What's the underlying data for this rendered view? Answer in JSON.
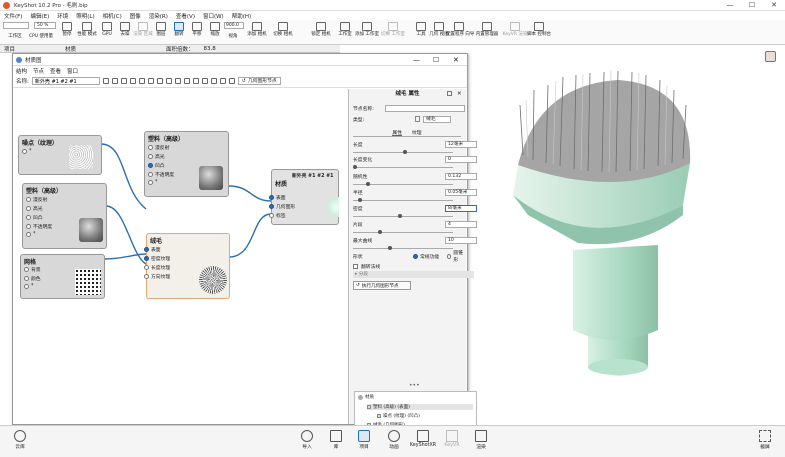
{
  "app": {
    "title": "KeyShot 10.2 Pro - 毛刷.bip",
    "min": "—",
    "max": "☐",
    "close": "✕"
  },
  "menu": [
    "文件(F)",
    "编辑(E)",
    "环境",
    "照明(L)",
    "相机(C)",
    "图像",
    "渲染(R)",
    "查看(V)",
    "窗口(W)",
    "帮助(H)"
  ],
  "toolbar": {
    "dropdown1": "",
    "zoom": "50 %",
    "zoom2": "900.0",
    "items": [
      {
        "label": "工作区"
      },
      {
        "label": "CPU 使用量"
      },
      {
        "label": "暂停"
      },
      {
        "label": "性能 模式"
      },
      {
        "label": "GPU"
      },
      {
        "label": "去噪"
      },
      {
        "label": "渲染 区域"
      },
      {
        "label": "图层"
      },
      {
        "label": "翻转"
      },
      {
        "label": "平移"
      },
      {
        "label": "缩放"
      },
      {
        "label": "视角"
      },
      {
        "label": "添加 相机"
      },
      {
        "label": "切换 相机"
      },
      {
        "label": "锁定 相机"
      },
      {
        "label": "工作室"
      },
      {
        "label": "添加 工作室"
      },
      {
        "label": "切换 工作室"
      },
      {
        "label": "工具"
      },
      {
        "label": "几何 视图"
      },
      {
        "label": "配置程序 向导"
      },
      {
        "label": "内置管理器"
      },
      {
        "label": "KeyVR 渲染"
      },
      {
        "label": "脚本 控制台"
      }
    ]
  },
  "subbar": {
    "left": "项目",
    "mid": "材质",
    "right": "面积倍数：",
    "right_val": "83.8"
  },
  "graph_window": {
    "title": "材质图",
    "menu": [
      "结构",
      "节点",
      "查看",
      "窗口"
    ],
    "name_label": "名称:",
    "name_value": "新外壳 #1 #2 #1",
    "search": "几何图形节点",
    "nodes": {
      "noise": {
        "title": "噪点（纹理）",
        "ports": [
          "*"
        ]
      },
      "plastic_top": {
        "title": "塑料（高级）",
        "ports": [
          "漫反射",
          "高光",
          "凹凸",
          "不透明度",
          "*"
        ]
      },
      "plastic_left": {
        "title": "塑料（高级）",
        "ports": [
          "漫反射",
          "高光",
          "凹凸",
          "不透明度",
          "*"
        ]
      },
      "grid": {
        "title": "网格",
        "ports": [
          "背景",
          "颜色",
          "*"
        ]
      },
      "fuzz": {
        "title": "绒毛",
        "ports": [
          "表面",
          "密度纹理",
          "长度纹理",
          "方向纹理"
        ]
      },
      "material": {
        "header": "新外壳 #1 #2 #1",
        "title": "材质",
        "ports": [
          "表面",
          "几何图形",
          "标签"
        ]
      }
    }
  },
  "props": {
    "header_a": "绒毛",
    "header_b": "属性",
    "node_name_label": "节点名称:",
    "node_name": "",
    "type_label": "类型:",
    "type_value": "绒毛",
    "tab_props": "属性",
    "tab_tex": "纹理",
    "rows": [
      {
        "label": "长度",
        "value": "12毫米",
        "knob": 0.5
      },
      {
        "label": "长度变化",
        "value": "0",
        "knob": 0.0
      },
      {
        "label": "随机性",
        "value": "0.132",
        "knob": 0.13
      },
      {
        "label": "半径",
        "value": "0.05毫米",
        "knob": 0.05
      },
      {
        "label": "密度",
        "value": "8/毫米",
        "knob": 0.45
      },
      {
        "label": "片段",
        "value": "4",
        "knob": 0.25
      },
      {
        "label": "最大曲线",
        "value": "10",
        "knob": 0.35
      }
    ],
    "shape_label": "形状",
    "shape_opt1": "常规功能",
    "shape_opt2": "圆锥形",
    "flip_label": "翻转法线",
    "collapsed_label": "▸ 分段",
    "exec_btn": "执行几何图形节点",
    "tree": [
      "材质",
      "塑料 (高级) (表面)",
      "噪点 (纹理) (凹凸)",
      "绒毛 (几何图形)",
      "网格 (密度纹理)",
      "塑料 (高级) (表面)"
    ]
  },
  "ribbon": {
    "left": "云库",
    "items": [
      "导入",
      "库",
      "项目",
      "动画",
      "KeyShotXR",
      "KeyVR",
      "渲染"
    ],
    "right": "截屏"
  },
  "colors": {
    "accent": "#1a73c8",
    "port_on": "#2a6fb5",
    "model_green": "#a8d8c0"
  }
}
